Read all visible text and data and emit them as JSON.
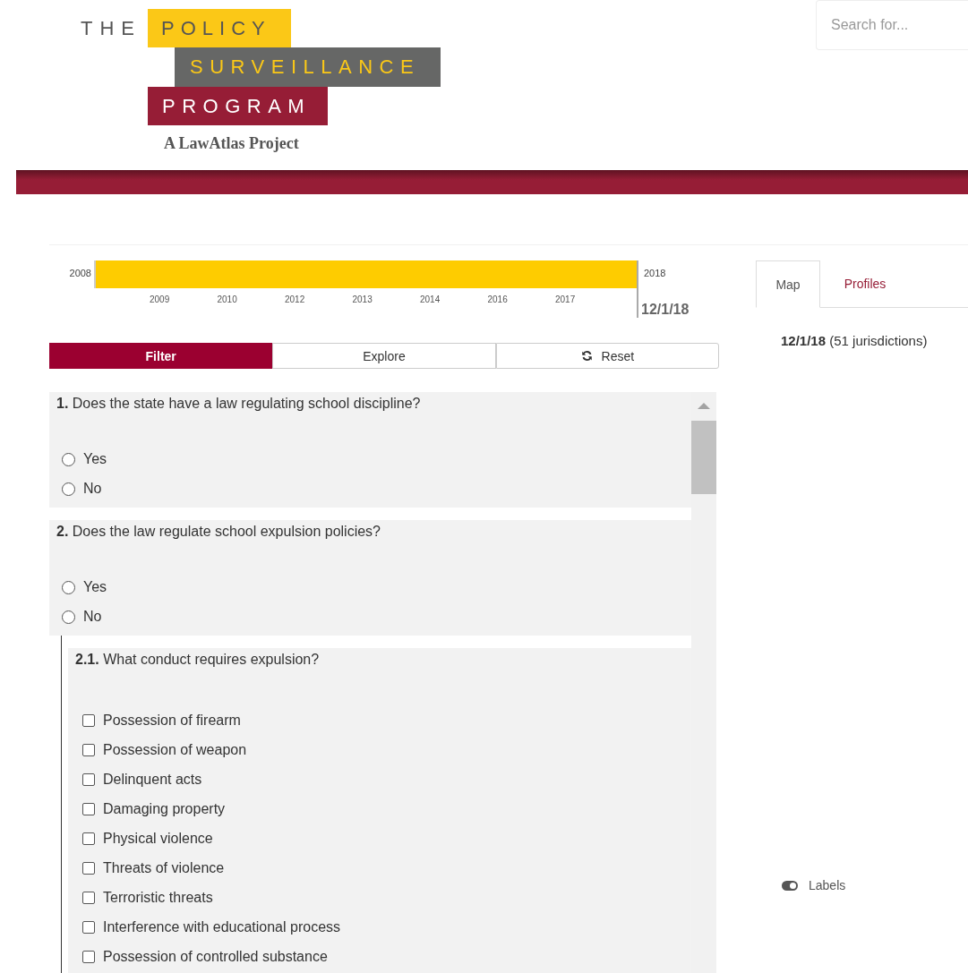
{
  "header": {
    "logo": {
      "the": "THE",
      "policy": "POLICY",
      "surveillance": "SURVEILLANCE",
      "program": "PROGRAM",
      "tagline": "A LawAtlas Project"
    },
    "search": {
      "placeholder": "Search for..."
    }
  },
  "timeline": {
    "start": "2008",
    "end": "2018",
    "ticks": [
      "2009",
      "2010",
      "2012",
      "2013",
      "2014",
      "2016",
      "2017"
    ],
    "current_date": "12/1/18"
  },
  "mode_tabs": [
    {
      "label": "Filter",
      "kind": "tab",
      "selected": true
    },
    {
      "label": "Explore",
      "kind": "tab",
      "selected": false
    },
    {
      "label": "Reset",
      "kind": "action",
      "selected": false
    }
  ],
  "questions": [
    {
      "number": "1.",
      "text": "Does the state have a law regulating school discipline?",
      "kind": "radio",
      "options": [
        {
          "label": "Yes",
          "checked": false
        },
        {
          "label": "No",
          "checked": false
        }
      ]
    },
    {
      "number": "2.",
      "text": "Does the law regulate school expulsion policies?",
      "kind": "radio",
      "options": [
        {
          "label": "Yes",
          "checked": false
        },
        {
          "label": "No",
          "checked": false
        }
      ],
      "children": [
        {
          "number": "2.1.",
          "text": "What conduct requires expulsion?",
          "kind": "checkbox",
          "options": [
            {
              "label": "Possession of firearm",
              "checked": false
            },
            {
              "label": "Possession of weapon",
              "checked": false
            },
            {
              "label": "Delinquent acts",
              "checked": false
            },
            {
              "label": "Damaging property",
              "checked": false
            },
            {
              "label": "Physical violence",
              "checked": false
            },
            {
              "label": "Threats of violence",
              "checked": false
            },
            {
              "label": "Terroristic threats",
              "checked": false
            },
            {
              "label": "Interference with educational process",
              "checked": false
            },
            {
              "label": "Possession of controlled substance",
              "checked": false
            }
          ]
        }
      ]
    }
  ],
  "view_tabs": [
    {
      "label": "Map",
      "selected": true
    },
    {
      "label": "Profiles",
      "selected": false
    }
  ],
  "date_summary": {
    "date": "12/1/18",
    "count": "(51 jurisdictions)"
  },
  "labels_toggle": {
    "label": "Labels",
    "on": true
  }
}
